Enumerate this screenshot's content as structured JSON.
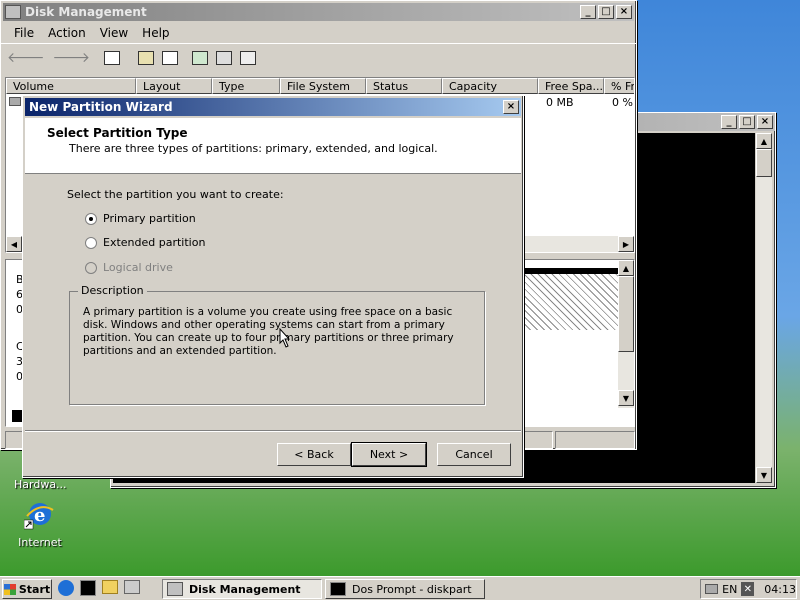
{
  "disk_mgmt": {
    "title": "Disk Management",
    "menu": [
      "File",
      "Action",
      "View",
      "Help"
    ],
    "columns": [
      "Volume",
      "Layout",
      "Type",
      "File System",
      "Status",
      "Capacity",
      "Free Spa...",
      "% Fre"
    ],
    "row_values": {
      "free": "0 MB",
      "pct": "0 %"
    },
    "disk_labels": [
      "B",
      "6",
      "0",
      "C",
      "3",
      "0"
    ]
  },
  "wizard": {
    "title": "New Partition Wizard",
    "heading": "Select Partition Type",
    "subheading": "There are three types of partitions: primary, extended, and logical.",
    "prompt": "Select the partition you want to create:",
    "options": [
      {
        "label": "Primary partition",
        "checked": true,
        "disabled": false
      },
      {
        "label": "Extended partition",
        "checked": false,
        "disabled": false
      },
      {
        "label": "Logical drive",
        "checked": false,
        "disabled": true
      }
    ],
    "description_title": "Description",
    "description": "A primary partition is a volume you create using free space on a basic disk. Windows and other operating systems can start from a primary partition. You can create up to four primary partitions or three primary partitions and an extended partition.",
    "back_label": "< Back",
    "next_label": "Next >",
    "cancel_label": "Cancel"
  },
  "desktop": {
    "icons": [
      {
        "label": "Hardwa...",
        "icon": "hardware-icon"
      },
      {
        "label": "Internet",
        "icon": "internet-explorer-icon"
      }
    ]
  },
  "taskbar": {
    "start_label": "Start",
    "tasks": [
      {
        "label": "Disk Management",
        "active": true
      },
      {
        "label": "Dos Prompt - diskpart",
        "active": false
      }
    ],
    "language": "EN",
    "clock": "04:13"
  },
  "colors": {
    "title_active": "#0a246a",
    "desktop_sky": "#3f86d9",
    "desktop_grass": "#3c9a2c"
  }
}
